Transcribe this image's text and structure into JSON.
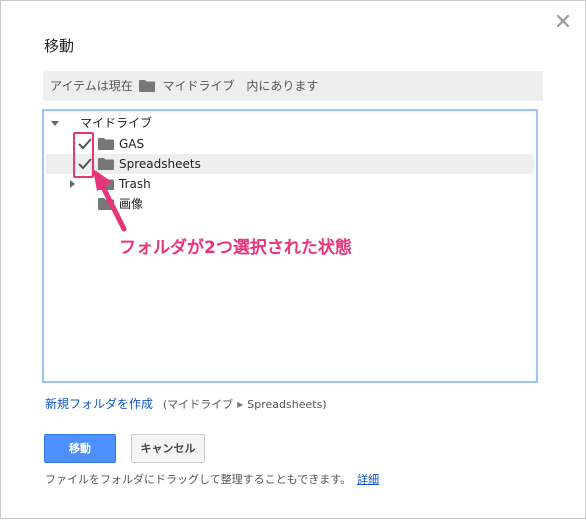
{
  "dialog": {
    "title": "移動",
    "close_icon": "close-icon"
  },
  "location": {
    "prefix": "アイテムは現在",
    "folder_name": "マイドライブ",
    "suffix": "内にあります"
  },
  "tree": {
    "root": {
      "label": "マイドライブ",
      "expanded": true
    },
    "items": [
      {
        "label": "GAS",
        "checked": true,
        "has_children": false
      },
      {
        "label": "Spreadsheets",
        "checked": true,
        "has_children": false,
        "highlighted": true
      },
      {
        "label": "Trash",
        "checked": false,
        "has_children": true
      },
      {
        "label": "画像",
        "checked": false,
        "has_children": false
      }
    ]
  },
  "annotation": {
    "text": "フォルダが2つ選択された状態",
    "color": "#e8357a"
  },
  "new_folder": {
    "link": "新規フォルダを作成",
    "path_open": "(",
    "path_root": "マイドライブ",
    "path_leaf": "Spreadsheets",
    "path_close": ")"
  },
  "buttons": {
    "move": "移動",
    "cancel": "キャンセル"
  },
  "hint": {
    "text": "ファイルをフォルダにドラッグして整理することもできます。",
    "more": "詳細"
  },
  "colors": {
    "primary": "#4d90fe",
    "link": "#1155cc",
    "tree_border": "#9fc3f3",
    "annotation": "#e8357a"
  }
}
